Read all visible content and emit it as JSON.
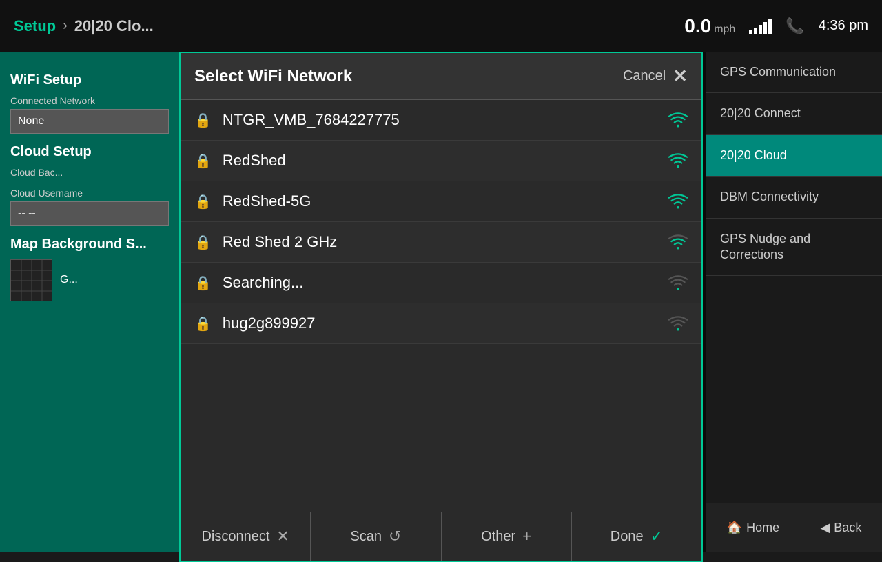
{
  "topbar": {
    "breadcrumb_setup": "Setup",
    "breadcrumb_arrow": "›",
    "breadcrumb_page": "20|20 Clo...",
    "speed_value": "0.0",
    "speed_unit": "mph",
    "clock": "4:36 pm"
  },
  "left_panel": {
    "wifi_section_title": "WiFi Setup",
    "connected_network_label": "Connected Network",
    "connected_network_value": "None",
    "cloud_section_title": "Cloud Setup",
    "cloud_backup_label": "Cloud Bac...",
    "cloud_username_label": "Cloud Username",
    "cloud_username_value": "-- --",
    "map_bg_label": "Map Background S..."
  },
  "right_sidebar": {
    "items": [
      {
        "id": "gps-comm",
        "label": "GPS Communication",
        "active": false
      },
      {
        "id": "2020-connect",
        "label": "20|20 Connect",
        "active": false
      },
      {
        "id": "2020-cloud",
        "label": "20|20 Cloud",
        "active": true
      },
      {
        "id": "dbm-conn",
        "label": "DBM Connectivity",
        "active": false
      },
      {
        "id": "gps-nudge",
        "label": "GPS Nudge and Corrections",
        "active": false
      }
    ]
  },
  "bottom_nav": {
    "home_label": "Home",
    "back_label": "Back"
  },
  "dialog": {
    "title": "Select WiFi Network",
    "cancel_label": "Cancel",
    "networks": [
      {
        "id": "net1",
        "name": "NTGR_VMB_7684227775",
        "signal": "strong"
      },
      {
        "id": "net2",
        "name": "RedShed",
        "signal": "medium"
      },
      {
        "id": "net3",
        "name": "RedShed-5G",
        "signal": "medium"
      },
      {
        "id": "net4",
        "name": "Red Shed 2 GHz",
        "signal": "medium-weak"
      },
      {
        "id": "net5",
        "name": "Searching...",
        "signal": "weak"
      },
      {
        "id": "net6",
        "name": "hug2g899927",
        "signal": "weak"
      }
    ],
    "footer_buttons": [
      {
        "id": "disconnect",
        "label": "Disconnect",
        "icon": "✕"
      },
      {
        "id": "scan",
        "label": "Scan",
        "icon": "↺"
      },
      {
        "id": "other",
        "label": "Other",
        "icon": "+"
      },
      {
        "id": "done",
        "label": "Done",
        "icon": "✓"
      }
    ]
  }
}
